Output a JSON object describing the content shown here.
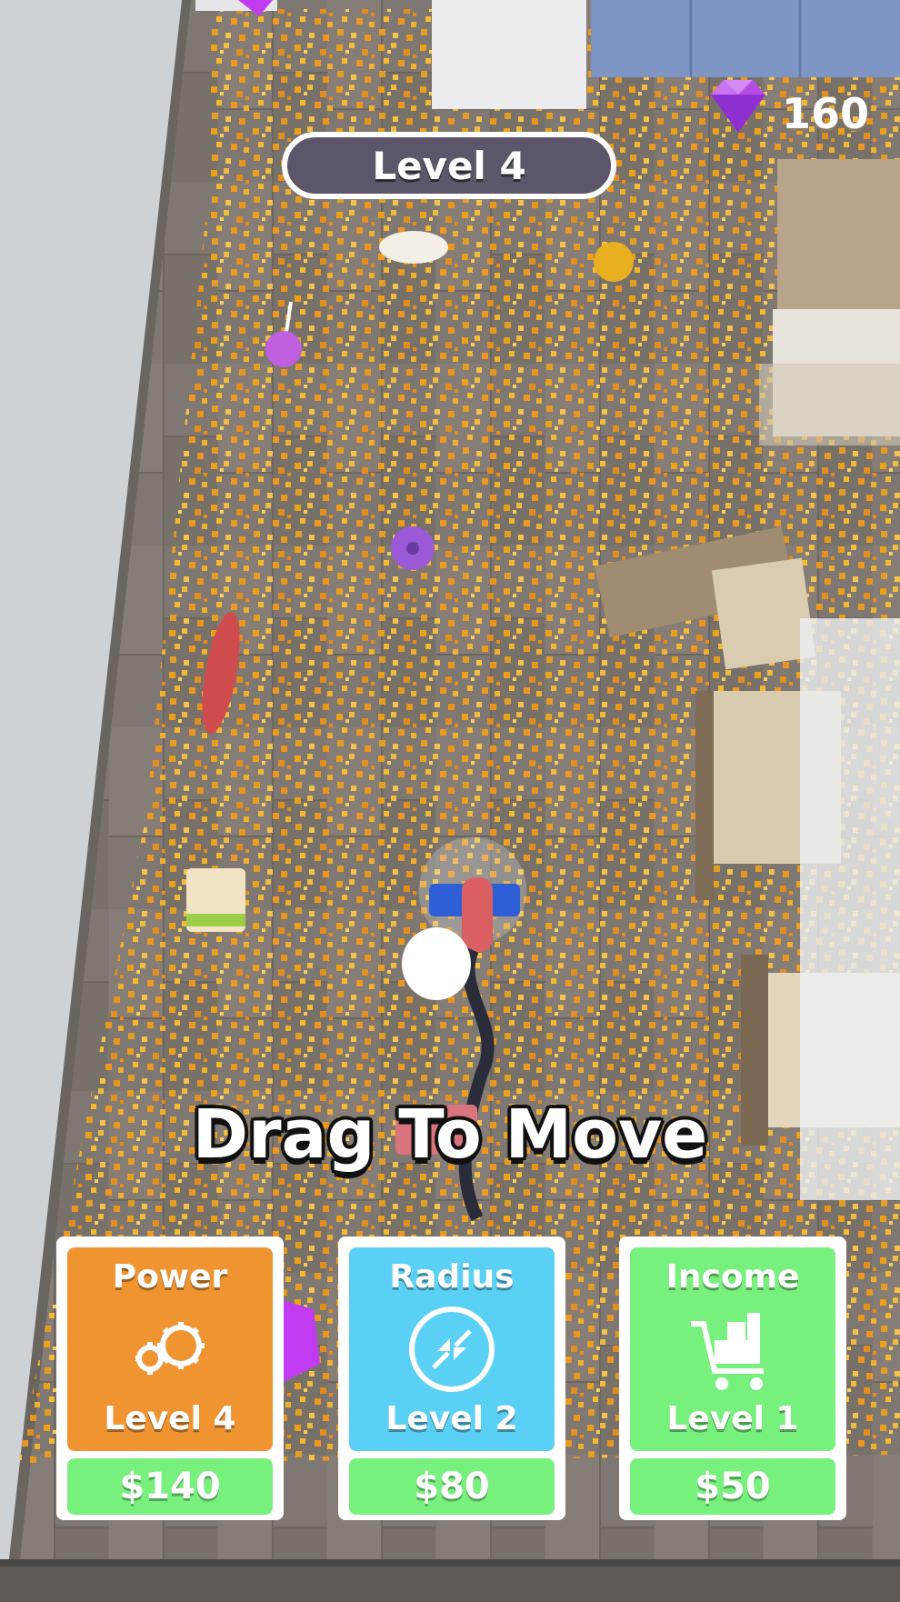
{
  "hud": {
    "level_label": "Level 4",
    "gem_count": "160",
    "hint": "Drag To Move"
  },
  "upgrades": [
    {
      "title": "Power",
      "icon": "gears-icon",
      "level": "Level 4",
      "price": "$140",
      "color": "#f09432"
    },
    {
      "title": "Radius",
      "icon": "radius-icon",
      "level": "Level 2",
      "price": "$80",
      "color": "#5bd0f5"
    },
    {
      "title": "Income",
      "icon": "cart-icon",
      "level": "Level 1",
      "price": "$50",
      "color": "#78f07e"
    }
  ],
  "colors": {
    "floor": "#7e7770",
    "debris": "#f0a21c",
    "gem": "#b44ee8",
    "price_button": "#78f07e"
  }
}
